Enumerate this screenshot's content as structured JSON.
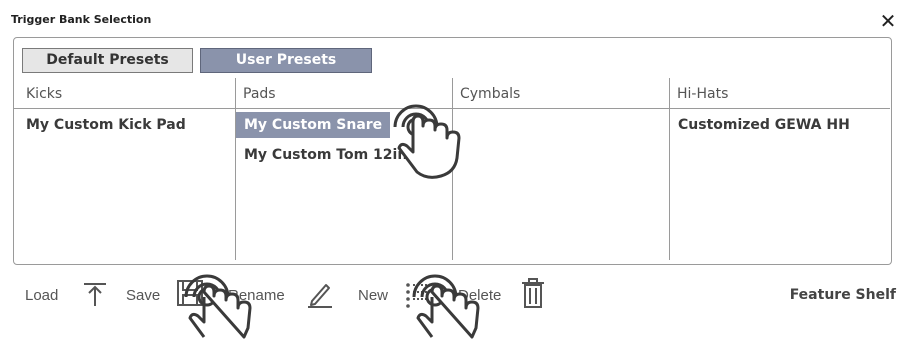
{
  "dialog": {
    "title": "Trigger Bank Selection",
    "close_icon": "close-icon"
  },
  "tabs": [
    {
      "label": "Default Presets",
      "active": false
    },
    {
      "label": "User Presets",
      "active": true
    }
  ],
  "columns": [
    {
      "header": "Kicks",
      "items": [
        "My Custom Kick Pad"
      ]
    },
    {
      "header": "Pads",
      "items": [
        "My Custom Snare",
        "My Custom Tom 12in"
      ],
      "selected": "My Custom Snare"
    },
    {
      "header": "Cymbals",
      "items": []
    },
    {
      "header": "Hi-Hats",
      "items": [
        "Customized GEWA HH"
      ]
    }
  ],
  "toolbar": {
    "load": "Load",
    "save": "Save",
    "rename": "Rename",
    "new": "New",
    "delete": "Delete",
    "feature_shelf": "Feature Shelf"
  },
  "colors": {
    "selected_bg": "#8a93ab",
    "tab_default_bg": "#e6e6e6"
  }
}
